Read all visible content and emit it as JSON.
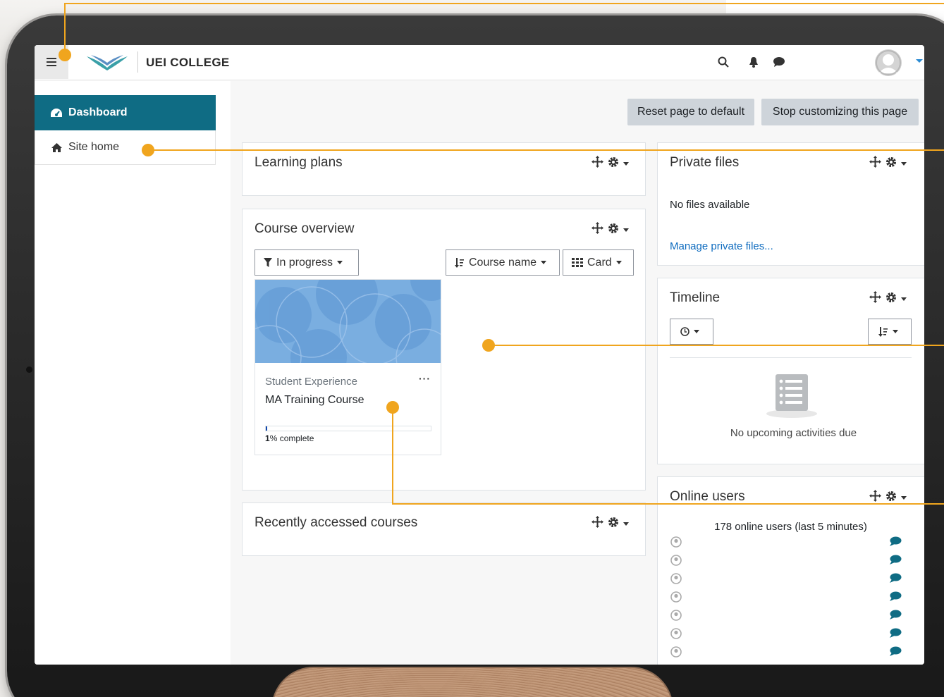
{
  "brand": {
    "name": "UEI COLLEGE"
  },
  "colors": {
    "accent": "#0f6c84",
    "link": "#0f6cbf",
    "callout": "#f0a51e"
  },
  "sidebar": {
    "items": [
      {
        "label": "Dashboard",
        "icon": "dashboard-icon",
        "active": true
      },
      {
        "label": "Site home",
        "icon": "home-icon",
        "active": false
      }
    ]
  },
  "page_actions": {
    "reset_label": "Reset page to default",
    "stop_label": "Stop customizing this page"
  },
  "learning_plans": {
    "title": "Learning plans"
  },
  "course_overview": {
    "title": "Course overview",
    "filter_label": "In progress",
    "sort_label": "Course name",
    "view_label": "Card",
    "course": {
      "category": "Student Experience",
      "name": "MA Training Course",
      "progress_percent": 1,
      "progress_text": "% complete",
      "progress_number": "1"
    }
  },
  "recently_accessed": {
    "title": "Recently accessed courses"
  },
  "private_files": {
    "title": "Private files",
    "empty_text": "No files available",
    "manage_link": "Manage private files..."
  },
  "timeline": {
    "title": "Timeline",
    "empty_text": "No upcoming activities due"
  },
  "online_users": {
    "title": "Online users",
    "summary": "178 online users (last 5 minutes)",
    "user_rows": 7
  }
}
